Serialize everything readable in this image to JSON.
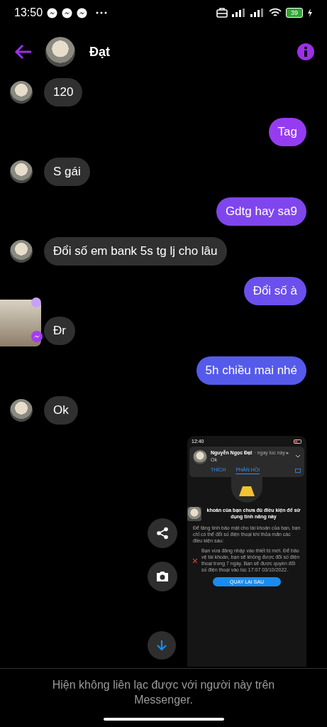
{
  "status_bar": {
    "time": "13:50",
    "battery": "39"
  },
  "header": {
    "contact_name": "Đạt"
  },
  "messages": [
    {
      "kind": "received",
      "text": "120"
    },
    {
      "kind": "sent",
      "text": "Tag"
    },
    {
      "kind": "received",
      "text": "S gái"
    },
    {
      "kind": "sent",
      "text": "Gdtg hay sa9"
    },
    {
      "kind": "received",
      "text": "Đổi số em bank 5s tg lj cho lâu"
    },
    {
      "kind": "sent",
      "text": "Đổi số à"
    },
    {
      "kind": "received",
      "text": "Đr"
    },
    {
      "kind": "sent",
      "text": "5h chiều mai nhé"
    },
    {
      "kind": "received",
      "text": "Ok"
    }
  ],
  "image_message": {
    "time": "12:40",
    "notification": {
      "name": "Nguyễn Ngọc Đạt",
      "when": "· ngay lúc này ▸",
      "text": "Ok",
      "actions": [
        {
          "label": "THÍCH",
          "selected": false
        },
        {
          "label": "PHẢN HỒI",
          "selected": true
        }
      ]
    },
    "heading": "khoản của bạn chưa đủ điều kiện để sử dụng tính năng này",
    "intro": "Để tăng tính bảo mật cho tài khoản của bạn, bạn chỉ có thể đổi số điện thoại khi thỏa mãn các điều kiện sau:",
    "condition": "Bạn vừa đăng nhập vào thiết bị mới. Để bảo vệ tài khoản, bạn sẽ không được đổi số điện thoại trong 7 ngày. Bạn sẽ được quyền đổi số điện thoại vào lúc 17:07 03/10/2022.",
    "button": "QUAY LẠI SAU"
  },
  "footer": {
    "notice": "Hiện không liên lạc được với người này trên Messenger."
  }
}
